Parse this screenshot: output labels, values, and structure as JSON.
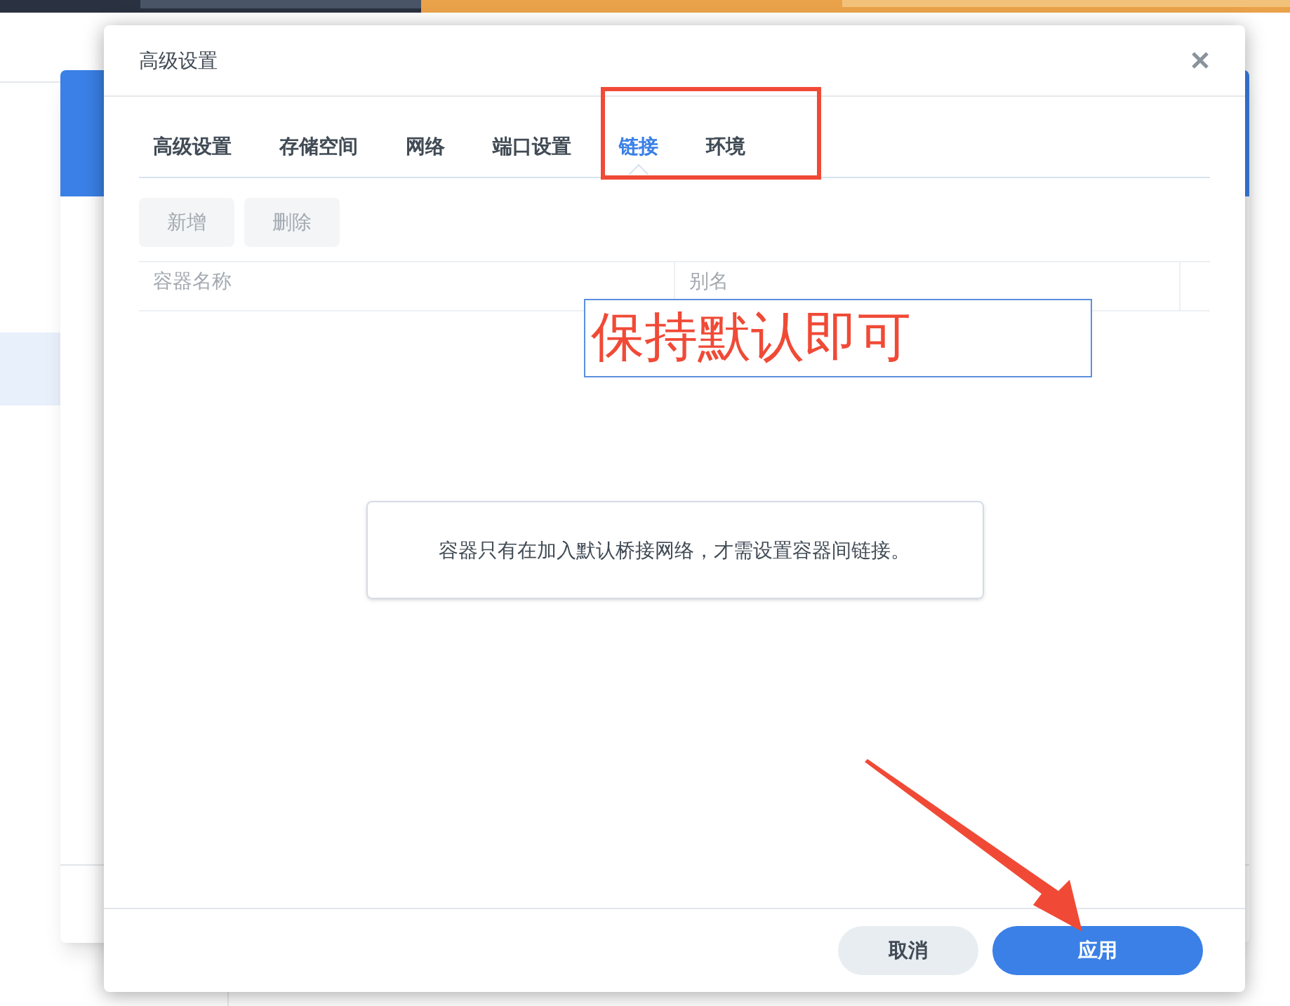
{
  "dialog": {
    "title": "高级设置"
  },
  "tabs": [
    {
      "label": "高级设置",
      "selected": false
    },
    {
      "label": "存储空间",
      "selected": false
    },
    {
      "label": "网络",
      "selected": false
    },
    {
      "label": "端口设置",
      "selected": false
    },
    {
      "label": "链接",
      "selected": true
    },
    {
      "label": "环境",
      "selected": false
    }
  ],
  "toolbar": [
    {
      "label": "新增",
      "disabled": true
    },
    {
      "label": "删除",
      "disabled": true
    }
  ],
  "table": {
    "columns": [
      "容器名称",
      "别名"
    ]
  },
  "annotation": "保持默认即可",
  "notice": "容器只有在加入默认桥接网络，才需设置容器间链接。",
  "footer": [
    {
      "label": "取消",
      "kind": "secondary"
    },
    {
      "label": "应用",
      "kind": "primary"
    }
  ]
}
